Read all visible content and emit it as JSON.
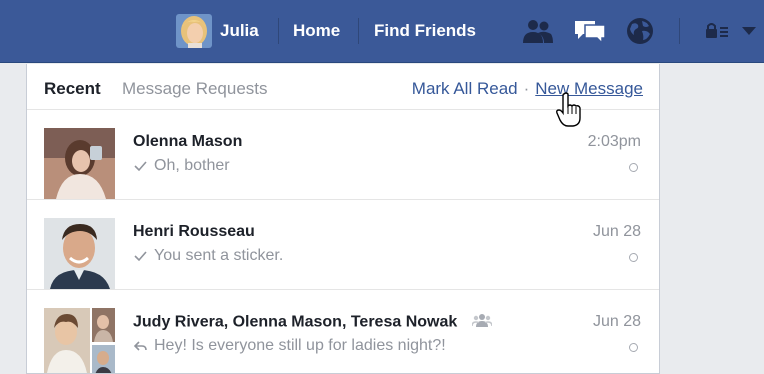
{
  "topbar": {
    "user_name": "Julia",
    "links": [
      "Home",
      "Find Friends"
    ],
    "icons": [
      "friends-icon",
      "messages-icon",
      "notifications-globe-icon",
      "privacy-shortcuts-icon",
      "account-menu-caret-icon"
    ],
    "colors": {
      "bar": "#3b5998",
      "text": "#ffffff"
    }
  },
  "panel": {
    "tabs": [
      "Recent",
      "Message Requests"
    ],
    "actions": {
      "mark_all_read": "Mark All Read",
      "separator": "·",
      "new_message": "New Message"
    },
    "colors": {
      "link": "#365899",
      "muted": "#90949c",
      "name": "#1d2129"
    }
  },
  "conversations": [
    {
      "name": "Olenna Mason",
      "snippet": "Oh, bother",
      "snippet_icon": "check-icon",
      "time": "2:03pm",
      "group": false
    },
    {
      "name": "Henri Rousseau",
      "snippet": "You sent a sticker.",
      "snippet_icon": "check-icon",
      "time": "Jun 28",
      "group": false
    },
    {
      "name": "Judy Rivera, Olenna Mason, Teresa Nowak",
      "snippet": "Hey! Is everyone still up for ladies night?!",
      "snippet_icon": "reply-icon",
      "time": "Jun 28",
      "group": true
    }
  ]
}
